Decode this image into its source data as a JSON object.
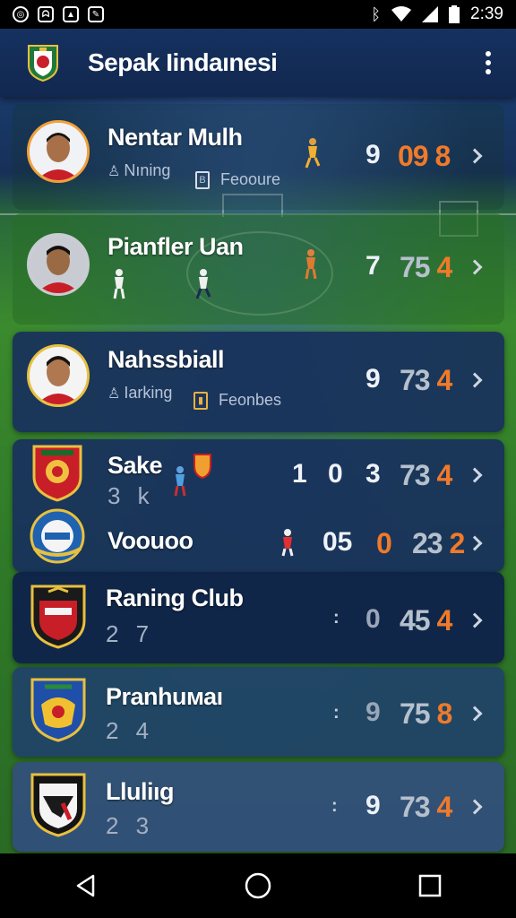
{
  "status_bar": {
    "time": "2:39",
    "left_icons": [
      "app-notification-icon",
      "app-notification-icon",
      "image-notification-icon",
      "app-notification-icon"
    ],
    "right_icons": [
      "bluetooth-icon",
      "wifi-icon",
      "signal-icon",
      "battery-icon"
    ]
  },
  "app_bar": {
    "title": "Sepak Iindaınesi",
    "logo_icon": "club-crest-icon",
    "menu_icon": "overflow-menu-icon"
  },
  "players": [
    {
      "name": "Nentar Mulh",
      "sub_left": "Nıning",
      "sub_right": "Feooure",
      "number": "9",
      "stat_grey": "",
      "stat_orange": "09 8"
    },
    {
      "name": "Pianfler Uan",
      "sub_left": "",
      "sub_right": "",
      "number": "7",
      "stat_grey": "75",
      "stat_orange": "4"
    },
    {
      "name": "Nahssbiall",
      "sub_left": "Iarking",
      "sub_right": "Feonbes",
      "number": "9",
      "stat_grey": "73",
      "stat_orange": "4"
    }
  ],
  "teams": [
    {
      "name": "Sake",
      "code": "3 k",
      "score_a": "1",
      "score_b": "0",
      "number": "3",
      "stat_grey": "73",
      "stat_orange": "4"
    },
    {
      "name": "Voouoo",
      "code": "",
      "score_a": "",
      "score_b": "05",
      "number": "0",
      "stat_grey": "23",
      "stat_orange": "2"
    },
    {
      "name": "Raning Club",
      "code": "2 7",
      "separator": ":",
      "number": "0",
      "stat_grey": "45",
      "stat_orange": "4"
    },
    {
      "name": "Pranhuмаı",
      "code": "2 4",
      "separator": ":",
      "number": "9",
      "stat_grey": "75",
      "stat_orange": "8"
    },
    {
      "name": "Lluliıg",
      "code": "2 3",
      "separator": ":",
      "number": "9",
      "stat_grey": "73",
      "stat_orange": "4"
    }
  ],
  "colors": {
    "accent": "#f07a2a",
    "app_bar": "#15315f",
    "pitch": "#3b8a2e"
  },
  "nav_bar": {
    "icons": [
      "back-icon",
      "home-icon",
      "recents-icon"
    ]
  }
}
